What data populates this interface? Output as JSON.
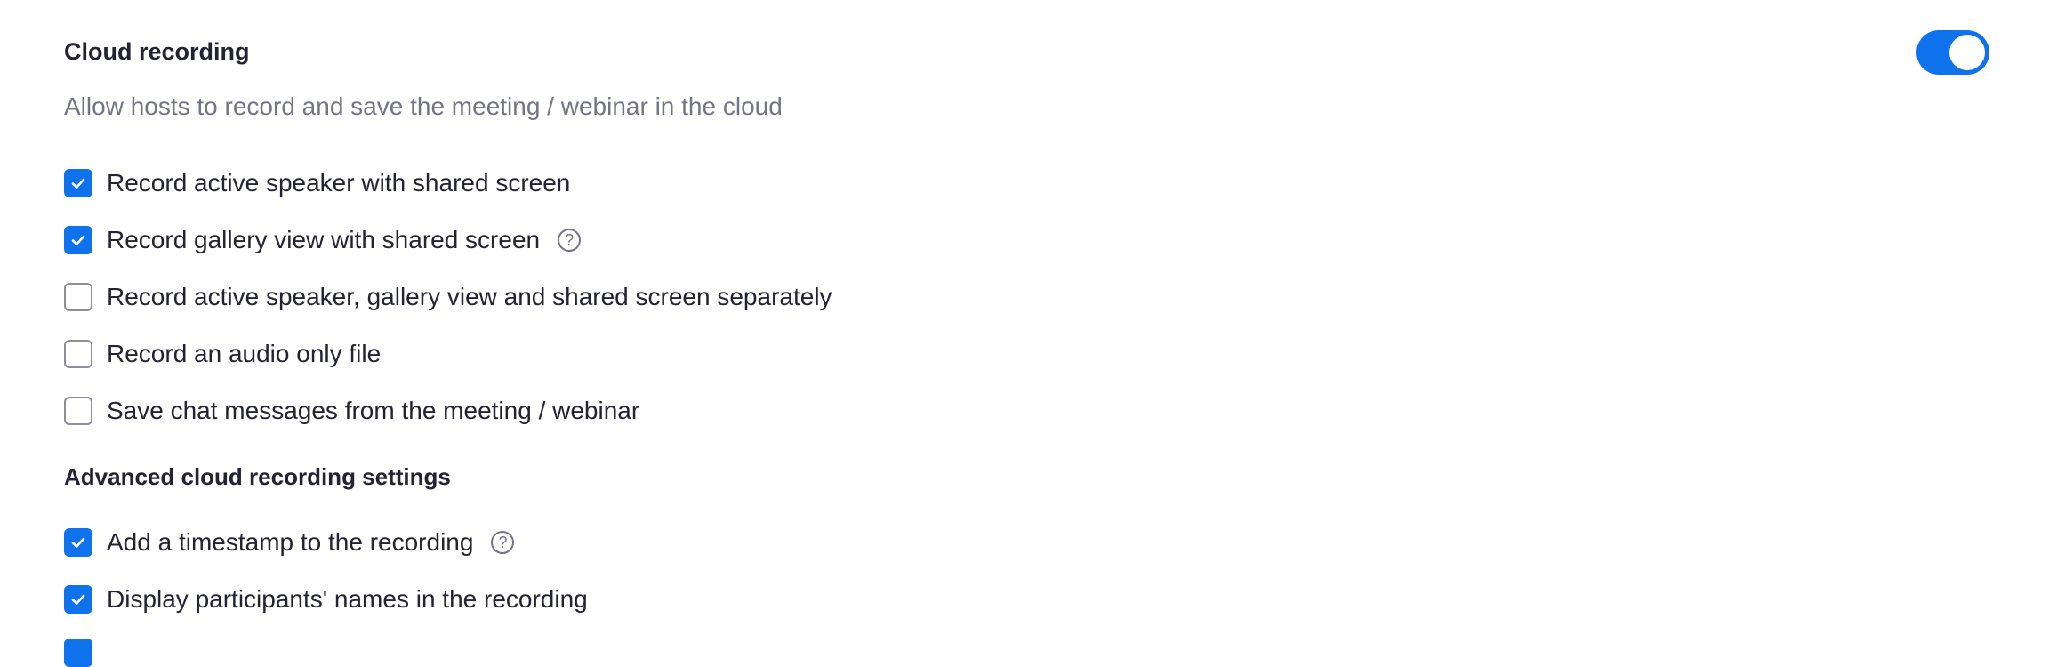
{
  "cloud_recording": {
    "title": "Cloud recording",
    "description": "Allow hosts to record and save the meeting / webinar in the cloud",
    "enabled": true,
    "options": [
      {
        "label": "Record active speaker with shared screen",
        "checked": true,
        "help": false
      },
      {
        "label": "Record gallery view with shared screen",
        "checked": true,
        "help": true
      },
      {
        "label": "Record active speaker, gallery view and shared screen separately",
        "checked": false,
        "help": false
      },
      {
        "label": "Record an audio only file",
        "checked": false,
        "help": false
      },
      {
        "label": "Save chat messages from the meeting / webinar",
        "checked": false,
        "help": false
      }
    ]
  },
  "advanced": {
    "title": "Advanced cloud recording settings",
    "options": [
      {
        "label": "Add a timestamp to the recording",
        "checked": true,
        "help": true
      },
      {
        "label": "Display participants' names in the recording",
        "checked": true,
        "help": false
      }
    ]
  },
  "help_glyph": "?",
  "colors": {
    "accent": "#0e72ed",
    "text": "#232333",
    "muted": "#747487"
  }
}
